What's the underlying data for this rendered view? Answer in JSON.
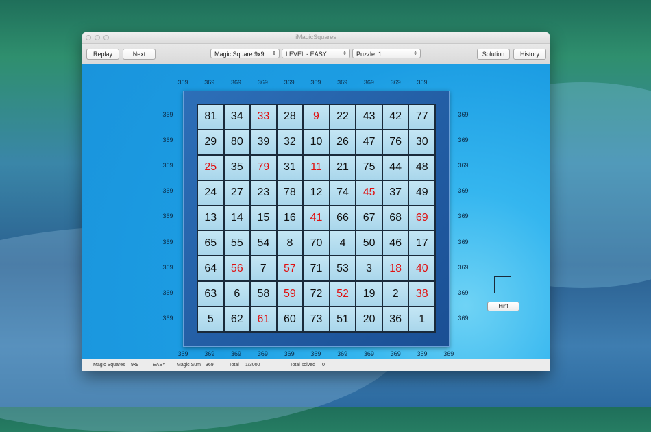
{
  "window": {
    "title": "iMagicSquares"
  },
  "toolbar": {
    "replay_label": "Replay",
    "next_label": "Next",
    "square_select": "Magic Square 9x9",
    "level_select": "LEVEL - EASY",
    "puzzle_select": "Puzzle: 1",
    "solution_label": "Solution",
    "history_label": "History"
  },
  "board": {
    "magic_sum": "369",
    "top_sums": [
      "369",
      "369",
      "369",
      "369",
      "369",
      "369",
      "369",
      "369",
      "369",
      "369"
    ],
    "bottom_sums": [
      "369",
      "369",
      "369",
      "369",
      "369",
      "369",
      "369",
      "369",
      "369",
      "369",
      "369"
    ],
    "left_sums": [
      "369",
      "369",
      "369",
      "369",
      "369",
      "369",
      "369",
      "369",
      "369"
    ],
    "right_sums": [
      "369",
      "369",
      "369",
      "369",
      "369",
      "369",
      "369",
      "369",
      "369"
    ],
    "rows": [
      [
        {
          "v": "81",
          "g": false
        },
        {
          "v": "34",
          "g": false
        },
        {
          "v": "33",
          "g": true
        },
        {
          "v": "28",
          "g": false
        },
        {
          "v": "9",
          "g": true
        },
        {
          "v": "22",
          "g": false
        },
        {
          "v": "43",
          "g": false
        },
        {
          "v": "42",
          "g": false
        },
        {
          "v": "77",
          "g": false
        }
      ],
      [
        {
          "v": "29",
          "g": false
        },
        {
          "v": "80",
          "g": false
        },
        {
          "v": "39",
          "g": false
        },
        {
          "v": "32",
          "g": false
        },
        {
          "v": "10",
          "g": false
        },
        {
          "v": "26",
          "g": false
        },
        {
          "v": "47",
          "g": false
        },
        {
          "v": "76",
          "g": false
        },
        {
          "v": "30",
          "g": false
        }
      ],
      [
        {
          "v": "25",
          "g": true
        },
        {
          "v": "35",
          "g": false
        },
        {
          "v": "79",
          "g": true
        },
        {
          "v": "31",
          "g": false
        },
        {
          "v": "11",
          "g": true
        },
        {
          "v": "21",
          "g": false
        },
        {
          "v": "75",
          "g": false
        },
        {
          "v": "44",
          "g": false
        },
        {
          "v": "48",
          "g": false
        }
      ],
      [
        {
          "v": "24",
          "g": false
        },
        {
          "v": "27",
          "g": false
        },
        {
          "v": "23",
          "g": false
        },
        {
          "v": "78",
          "g": false
        },
        {
          "v": "12",
          "g": false
        },
        {
          "v": "74",
          "g": false
        },
        {
          "v": "45",
          "g": true
        },
        {
          "v": "37",
          "g": false
        },
        {
          "v": "49",
          "g": false
        }
      ],
      [
        {
          "v": "13",
          "g": false
        },
        {
          "v": "14",
          "g": false
        },
        {
          "v": "15",
          "g": false
        },
        {
          "v": "16",
          "g": false
        },
        {
          "v": "41",
          "g": true
        },
        {
          "v": "66",
          "g": false
        },
        {
          "v": "67",
          "g": false
        },
        {
          "v": "68",
          "g": false
        },
        {
          "v": "69",
          "g": true
        }
      ],
      [
        {
          "v": "65",
          "g": false
        },
        {
          "v": "55",
          "g": false
        },
        {
          "v": "54",
          "g": false
        },
        {
          "v": "8",
          "g": false
        },
        {
          "v": "70",
          "g": false
        },
        {
          "v": "4",
          "g": false
        },
        {
          "v": "50",
          "g": false
        },
        {
          "v": "46",
          "g": false
        },
        {
          "v": "17",
          "g": false
        }
      ],
      [
        {
          "v": "64",
          "g": false
        },
        {
          "v": "56",
          "g": true
        },
        {
          "v": "7",
          "g": false
        },
        {
          "v": "57",
          "g": true
        },
        {
          "v": "71",
          "g": false
        },
        {
          "v": "53",
          "g": false
        },
        {
          "v": "3",
          "g": false
        },
        {
          "v": "18",
          "g": true
        },
        {
          "v": "40",
          "g": true
        }
      ],
      [
        {
          "v": "63",
          "g": false
        },
        {
          "v": "6",
          "g": false
        },
        {
          "v": "58",
          "g": false
        },
        {
          "v": "59",
          "g": true
        },
        {
          "v": "72",
          "g": false
        },
        {
          "v": "52",
          "g": true
        },
        {
          "v": "19",
          "g": false
        },
        {
          "v": "2",
          "g": false
        },
        {
          "v": "38",
          "g": true
        }
      ],
      [
        {
          "v": "5",
          "g": false
        },
        {
          "v": "62",
          "g": false
        },
        {
          "v": "61",
          "g": true
        },
        {
          "v": "60",
          "g": false
        },
        {
          "v": "73",
          "g": false
        },
        {
          "v": "51",
          "g": false
        },
        {
          "v": "20",
          "g": false
        },
        {
          "v": "36",
          "g": false
        },
        {
          "v": "1",
          "g": false
        }
      ]
    ],
    "hint_label": "Hint"
  },
  "status": {
    "app": "Magic Squares",
    "size": "9x9",
    "level": "EASY",
    "sum_label": "Magic Sum",
    "sum_value": "369",
    "total_label": "Total",
    "total_value": "1/3000",
    "solved_label": "Total solved",
    "solved_value": "0"
  },
  "colors": {
    "given_number": "#e01010",
    "canvas": "#1c9de3",
    "frame": "#1a4f94"
  }
}
